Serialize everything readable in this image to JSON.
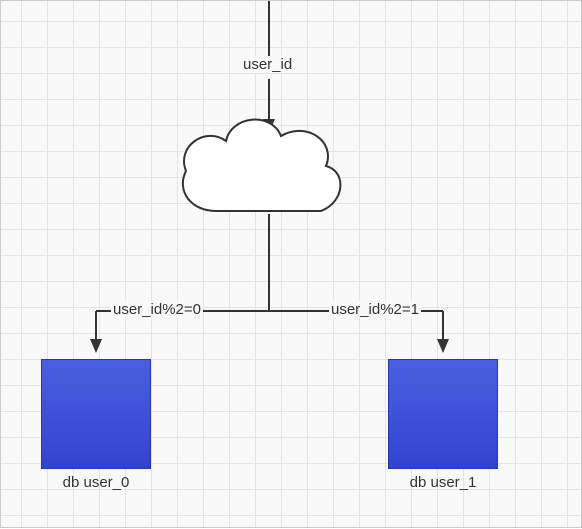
{
  "diagram": {
    "input_label": "user_id",
    "branch_left_label": "user_id%2=0",
    "branch_right_label": "user_id%2=1",
    "db_left_caption": "db user_0",
    "db_right_caption": "db user_1"
  },
  "colors": {
    "db_fill": "#3b4fe0",
    "stroke": "#333333"
  }
}
